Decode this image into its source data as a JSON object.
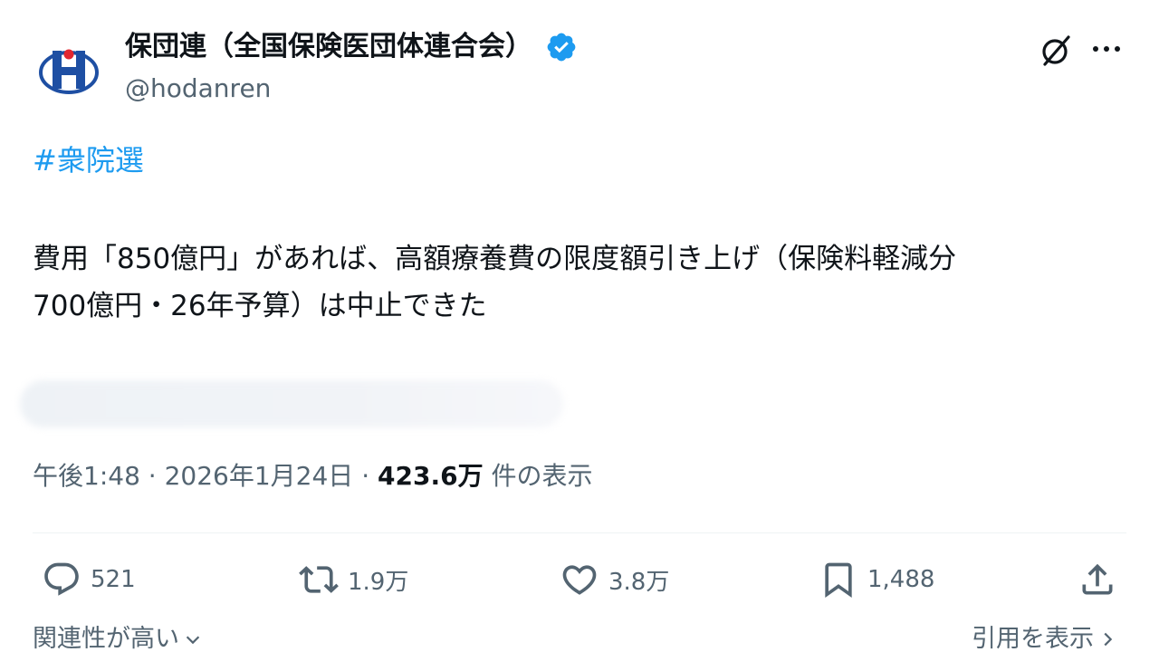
{
  "author": {
    "name": "保団連（全国保険医団体連合会）",
    "handle": "@hodanren"
  },
  "tweet": {
    "hashtag": "#衆院選",
    "text": "費用「850億円」があれば、高額療養費の限度額引き上げ（保険料軽減分\n700億円・26年予算）は中止できた",
    "time": "午後1:48",
    "separator": " · ",
    "date": "2026年1月24日",
    "views_count": "423.6万",
    "views_label": " 件の表示"
  },
  "actions": {
    "replies": "521",
    "reposts": "1.9万",
    "likes": "3.8万",
    "bookmarks": "1,488"
  },
  "footer": {
    "sort_label": "関連性が高い",
    "quotes_link": "引用を表示"
  },
  "colors": {
    "link": "#1d9bf0",
    "secondary_text": "#536471",
    "primary_text": "#0f1419",
    "logo_blue": "#1e4fa3",
    "logo_red": "#e3262f"
  }
}
